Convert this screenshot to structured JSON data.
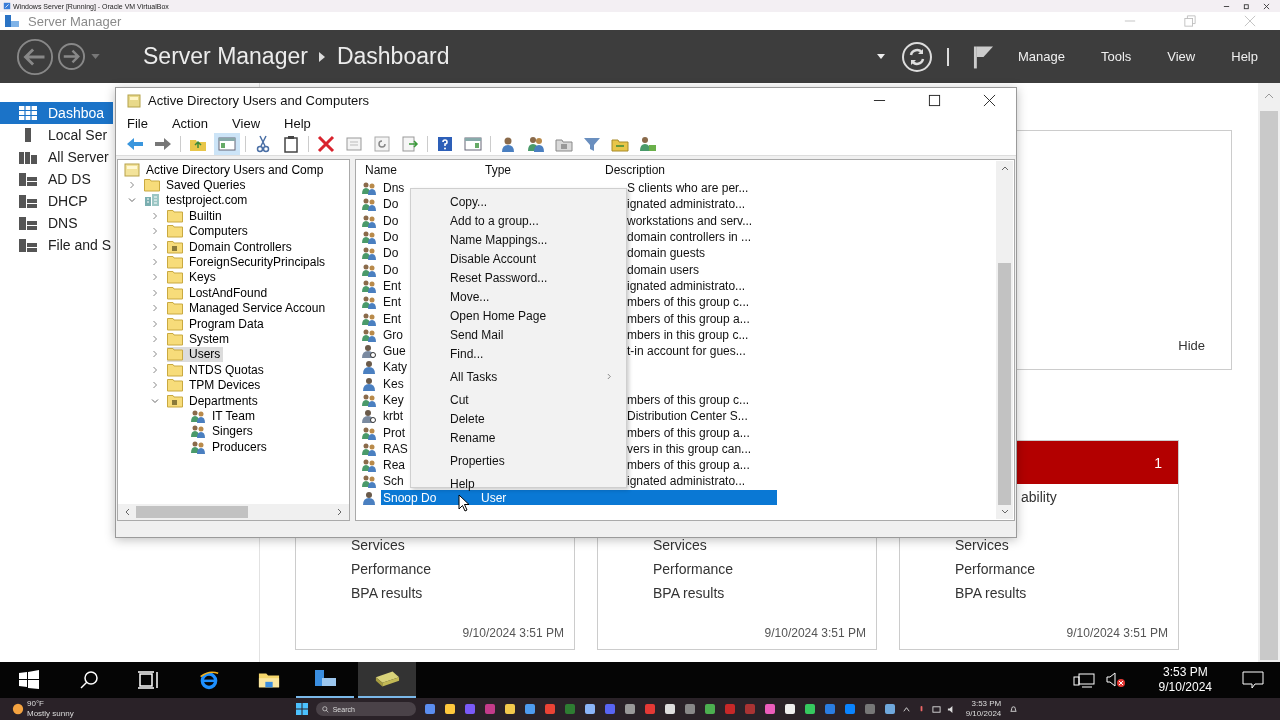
{
  "vbox": {
    "title": "Windows Server [Running] - Oracle VM VirtualBox"
  },
  "sm": {
    "title": "Server Manager",
    "crumbs": [
      "Server Manager",
      "Dashboard"
    ],
    "menu": [
      "Manage",
      "Tools",
      "View",
      "Help"
    ],
    "sidebar": [
      {
        "label": "Dashboa",
        "kind": "dashboard",
        "selected": true
      },
      {
        "label": "Local Ser",
        "kind": "local",
        "selected": false
      },
      {
        "label": "All Server",
        "kind": "all",
        "selected": false
      },
      {
        "label": "AD DS",
        "kind": "role",
        "selected": false
      },
      {
        "label": "DHCP",
        "kind": "role",
        "selected": false
      },
      {
        "label": "DNS",
        "kind": "role",
        "selected": false
      },
      {
        "label": "File and S",
        "kind": "role",
        "selected": false
      }
    ],
    "top_tile": {
      "hide": "Hide"
    },
    "tiles": [
      {
        "lines": [
          "Services",
          "Performance",
          "BPA results"
        ],
        "time": "9/10/2024 3:51 PM"
      },
      {
        "lines": [
          "Services",
          "Performance",
          "BPA results"
        ],
        "time": "9/10/2024 3:51 PM"
      },
      {
        "alert_count": "1",
        "status": "ability",
        "lines": [
          "Services",
          "Performance",
          "BPA results"
        ],
        "time": "9/10/2024 3:51 PM"
      }
    ]
  },
  "aduc": {
    "title": "Active Directory Users and Computers",
    "menu": [
      "File",
      "Action",
      "View",
      "Help"
    ],
    "tree": [
      {
        "label": "Active Directory Users and Comp",
        "kind": "root",
        "selected": false,
        "children": [
          {
            "label": "Saved Queries",
            "kind": "folder",
            "expanded": false,
            "selected": false
          },
          {
            "label": "testproject.com",
            "kind": "domain",
            "expanded": true,
            "selected": false,
            "children": [
              {
                "label": "Builtin",
                "kind": "folder",
                "expanded": false,
                "selected": false
              },
              {
                "label": "Computers",
                "kind": "folder",
                "expanded": false,
                "selected": false
              },
              {
                "label": "Domain Controllers",
                "kind": "ou",
                "expanded": false,
                "selected": false
              },
              {
                "label": "ForeignSecurityPrincipals",
                "kind": "folder",
                "expanded": false,
                "selected": false
              },
              {
                "label": "Keys",
                "kind": "folder",
                "expanded": false,
                "selected": false
              },
              {
                "label": "LostAndFound",
                "kind": "folder",
                "expanded": false,
                "selected": false
              },
              {
                "label": "Managed Service Accoun",
                "kind": "folder",
                "expanded": false,
                "selected": false
              },
              {
                "label": "Program Data",
                "kind": "folder",
                "expanded": false,
                "selected": false
              },
              {
                "label": "System",
                "kind": "folder",
                "expanded": false,
                "selected": false
              },
              {
                "label": "Users",
                "kind": "folder",
                "expanded": false,
                "selected": true
              },
              {
                "label": "NTDS Quotas",
                "kind": "folder",
                "expanded": false,
                "selected": false
              },
              {
                "label": "TPM Devices",
                "kind": "folder",
                "expanded": false,
                "selected": false
              },
              {
                "label": "Departments",
                "kind": "ou",
                "expanded": true,
                "selected": false,
                "children": [
                  {
                    "label": "IT Team",
                    "kind": "group",
                    "selected": false
                  },
                  {
                    "label": "Singers",
                    "kind": "group",
                    "selected": false
                  },
                  {
                    "label": "Producers",
                    "kind": "group",
                    "selected": false
                  }
                ]
              }
            ]
          }
        ]
      }
    ],
    "columns": [
      "Name",
      "Type",
      "Description"
    ],
    "rows": [
      {
        "name": "Dns",
        "kind": "group",
        "description": "S clients who are per...",
        "selected": false
      },
      {
        "name": "Do",
        "kind": "group",
        "description": "ignated administrato...",
        "selected": false
      },
      {
        "name": "Do",
        "kind": "group",
        "description": "workstations and serv...",
        "selected": false
      },
      {
        "name": "Do",
        "kind": "group",
        "description": "domain controllers in ...",
        "selected": false
      },
      {
        "name": "Do",
        "kind": "group",
        "description": "domain guests",
        "selected": false
      },
      {
        "name": "Do",
        "kind": "group",
        "description": "domain users",
        "selected": false
      },
      {
        "name": "Ent",
        "kind": "group",
        "description": "ignated administrato...",
        "selected": false
      },
      {
        "name": "Ent",
        "kind": "group",
        "description": "mbers of this group c...",
        "selected": false
      },
      {
        "name": "Ent",
        "kind": "group",
        "description": "mbers of this group a...",
        "selected": false
      },
      {
        "name": "Gro",
        "kind": "group",
        "description": "mbers in this group c...",
        "selected": false
      },
      {
        "name": "Gue",
        "kind": "special-user",
        "description": "t-in account for gues...",
        "selected": false
      },
      {
        "name": "Katy",
        "kind": "user",
        "selected": false
      },
      {
        "name": "Kes",
        "kind": "user",
        "selected": false
      },
      {
        "name": "Key",
        "kind": "group",
        "description": "mbers of this group c...",
        "selected": false
      },
      {
        "name": "krbt",
        "kind": "special-user",
        "description": "Distribution Center S...",
        "selected": false
      },
      {
        "name": "Prot",
        "kind": "group",
        "description": "mbers of this group a...",
        "selected": false
      },
      {
        "name": "RAS",
        "kind": "group",
        "description": "vers in this group can...",
        "selected": false
      },
      {
        "name": "Rea",
        "kind": "group",
        "description": "mbers of this group a...",
        "selected": false
      },
      {
        "name": "Sch",
        "kind": "group",
        "description": "ignated administrato...",
        "selected": false
      },
      {
        "name": "Snoop Do",
        "kind": "user",
        "type": "User",
        "selected": true
      }
    ],
    "context_menu": [
      {
        "kind": "item",
        "label": "Copy..."
      },
      {
        "kind": "item",
        "label": "Add to a group..."
      },
      {
        "kind": "item",
        "label": "Name Mappings..."
      },
      {
        "kind": "item",
        "label": "Disable Account"
      },
      {
        "kind": "item",
        "label": "Reset Password..."
      },
      {
        "kind": "item",
        "label": "Move..."
      },
      {
        "kind": "item",
        "label": "Open Home Page"
      },
      {
        "kind": "item",
        "label": "Send Mail"
      },
      {
        "kind": "item",
        "label": "Find..."
      },
      {
        "kind": "separator"
      },
      {
        "kind": "submenu",
        "label": "All Tasks"
      },
      {
        "kind": "separator"
      },
      {
        "kind": "item",
        "label": "Cut"
      },
      {
        "kind": "item",
        "label": "Delete"
      },
      {
        "kind": "item",
        "label": "Rename"
      },
      {
        "kind": "separator"
      },
      {
        "kind": "item",
        "label": "Properties"
      },
      {
        "kind": "separator"
      },
      {
        "kind": "item",
        "label": "Help"
      }
    ]
  },
  "vm_taskbar": {
    "time": "3:53 PM",
    "date": "9/10/2024"
  },
  "host_taskbar": {
    "temperature": "90°F",
    "weather": "Mostly sunny",
    "search": "Search",
    "time": "3:53 PM",
    "date": "9/10/2024"
  }
}
